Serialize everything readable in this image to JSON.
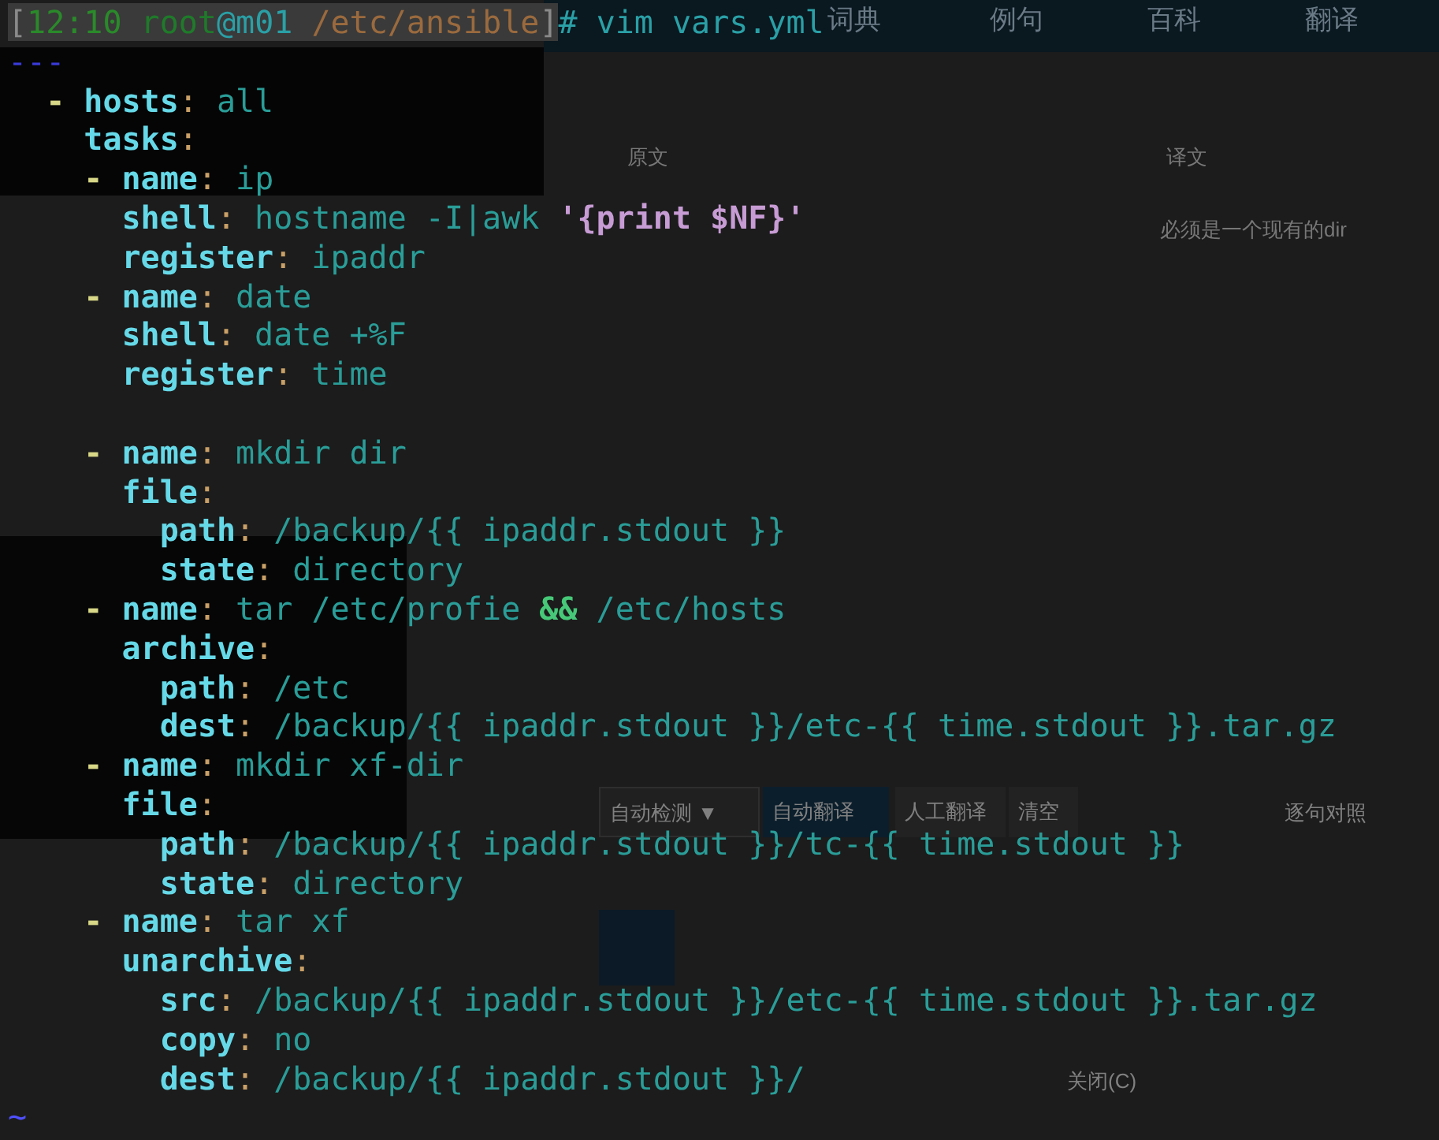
{
  "background_window": {
    "tabs": [
      "词典",
      "例句",
      "百科",
      "翻译"
    ],
    "columns": [
      "原文",
      "译文"
    ],
    "hint": "必须是一个现有的dir",
    "toolbar": [
      "自动检测 ▼",
      "自动翻译",
      "人工翻译",
      "清空"
    ],
    "compare": "逐句对照",
    "close": "关闭(C)"
  },
  "terminal": {
    "lines": [
      {
        "segments": [
          {
            "text": "[",
            "kind": "pb"
          },
          {
            "text": "12:10",
            "kind": "pt"
          },
          {
            "text": " root",
            "kind": "pu"
          },
          {
            "text": "@m01",
            "kind": "ph"
          },
          {
            "text": " /etc/ansible",
            "kind": "pp"
          },
          {
            "text": "]",
            "kind": "pb"
          },
          {
            "text": "# vim vars.yml",
            "kind": "pc"
          }
        ]
      },
      {
        "segments": [
          {
            "text": "---",
            "kind": "doc"
          }
        ]
      },
      {
        "segments": [
          {
            "text": "  -",
            "kind": "dash"
          },
          {
            "text": " hosts",
            "kind": "key"
          },
          {
            "text": ":",
            "kind": "colon"
          },
          {
            "text": " all",
            "kind": "v"
          }
        ]
      },
      {
        "segments": [
          {
            "text": "    tasks",
            "kind": "key"
          },
          {
            "text": ":",
            "kind": "colon"
          }
        ]
      },
      {
        "segments": [
          {
            "text": "    -",
            "kind": "dash"
          },
          {
            "text": " name",
            "kind": "key"
          },
          {
            "text": ":",
            "kind": "colon"
          },
          {
            "text": " ip",
            "kind": "v"
          }
        ]
      },
      {
        "segments": [
          {
            "text": "      shell",
            "kind": "key"
          },
          {
            "text": ":",
            "kind": "colon"
          },
          {
            "text": " hostname -I|awk",
            "kind": "v"
          },
          {
            "text": " '{print $NF}'",
            "kind": "str"
          }
        ]
      },
      {
        "segments": [
          {
            "text": "      register",
            "kind": "key"
          },
          {
            "text": ":",
            "kind": "colon"
          },
          {
            "text": " ipaddr",
            "kind": "v"
          }
        ]
      },
      {
        "segments": [
          {
            "text": "    -",
            "kind": "dash"
          },
          {
            "text": " name",
            "kind": "key"
          },
          {
            "text": ":",
            "kind": "colon"
          },
          {
            "text": " date",
            "kind": "v"
          }
        ]
      },
      {
        "segments": [
          {
            "text": "      shell",
            "kind": "key"
          },
          {
            "text": ":",
            "kind": "colon"
          },
          {
            "text": " date +%F",
            "kind": "v"
          }
        ]
      },
      {
        "segments": [
          {
            "text": "      register",
            "kind": "key"
          },
          {
            "text": ":",
            "kind": "colon"
          },
          {
            "text": " time",
            "kind": "v"
          }
        ]
      },
      {
        "blank_line_before": true,
        "segments": [
          {
            "text": "    -",
            "kind": "dash"
          },
          {
            "text": " name",
            "kind": "key"
          },
          {
            "text": ":",
            "kind": "colon"
          },
          {
            "text": " mkdir dir",
            "kind": "v"
          }
        ]
      },
      {
        "segments": [
          {
            "text": "      file",
            "kind": "key"
          },
          {
            "text": ":",
            "kind": "colon"
          }
        ]
      },
      {
        "segments": [
          {
            "text": "        path",
            "kind": "key"
          },
          {
            "text": ":",
            "kind": "colon"
          },
          {
            "text": " /backup/{{ ipaddr.stdout }}",
            "kind": "v"
          }
        ]
      },
      {
        "segments": [
          {
            "text": "        state",
            "kind": "key"
          },
          {
            "text": ":",
            "kind": "colon"
          },
          {
            "text": " directory",
            "kind": "v"
          }
        ]
      },
      {
        "segments": [
          {
            "text": "    -",
            "kind": "dash"
          },
          {
            "text": " name",
            "kind": "key"
          },
          {
            "text": ":",
            "kind": "colon"
          },
          {
            "text": " tar /etc/profie",
            "kind": "v"
          },
          {
            "text": " &&",
            "kind": "op"
          },
          {
            "text": " /etc/hosts",
            "kind": "v"
          }
        ]
      },
      {
        "segments": [
          {
            "text": "      archive",
            "kind": "key"
          },
          {
            "text": ":",
            "kind": "colon"
          }
        ]
      },
      {
        "segments": [
          {
            "text": "        path",
            "kind": "key"
          },
          {
            "text": ":",
            "kind": "colon"
          },
          {
            "text": " /etc",
            "kind": "v"
          }
        ]
      },
      {
        "segments": [
          {
            "text": "        dest",
            "kind": "key"
          },
          {
            "text": ":",
            "kind": "colon"
          },
          {
            "text": " /backup/{{ ipaddr.stdout }}/etc-{{ time.stdout }}.tar.gz",
            "kind": "v"
          }
        ]
      },
      {
        "segments": [
          {
            "text": "    -",
            "kind": "dash"
          },
          {
            "text": " name",
            "kind": "key"
          },
          {
            "text": ":",
            "kind": "colon"
          },
          {
            "text": " mkdir xf-dir",
            "kind": "v"
          }
        ]
      },
      {
        "segments": [
          {
            "text": "      file",
            "kind": "key"
          },
          {
            "text": ":",
            "kind": "colon"
          }
        ]
      },
      {
        "segments": [
          {
            "text": "        path",
            "kind": "key"
          },
          {
            "text": ":",
            "kind": "colon"
          },
          {
            "text": " /backup/{{ ipaddr.stdout }}/tc-{{ time.stdout }}",
            "kind": "v"
          }
        ]
      },
      {
        "segments": [
          {
            "text": "        state",
            "kind": "key"
          },
          {
            "text": ":",
            "kind": "colon"
          },
          {
            "text": " directory",
            "kind": "v"
          }
        ]
      },
      {
        "segments": [
          {
            "text": "    -",
            "kind": "dash"
          },
          {
            "text": " name",
            "kind": "key"
          },
          {
            "text": ":",
            "kind": "colon"
          },
          {
            "text": " tar xf",
            "kind": "v"
          }
        ]
      },
      {
        "segments": [
          {
            "text": "      unarchive",
            "kind": "key"
          },
          {
            "text": ":",
            "kind": "colon"
          }
        ]
      },
      {
        "segments": [
          {
            "text": "        src",
            "kind": "key"
          },
          {
            "text": ":",
            "kind": "colon"
          },
          {
            "text": " /backup/{{ ipaddr.stdout }}/etc-{{ time.stdout }}.tar.gz",
            "kind": "v"
          }
        ]
      },
      {
        "segments": [
          {
            "text": "        copy",
            "kind": "key"
          },
          {
            "text": ":",
            "kind": "colon"
          },
          {
            "text": " no",
            "kind": "v"
          }
        ]
      },
      {
        "segments": [
          {
            "text": "        dest",
            "kind": "key"
          },
          {
            "text": ":",
            "kind": "colon"
          },
          {
            "text": " /backup/{{ ipaddr.stdout }}/",
            "kind": "v"
          }
        ]
      },
      {
        "segments": [
          {
            "text": "~",
            "kind": "tilde"
          }
        ]
      }
    ]
  }
}
